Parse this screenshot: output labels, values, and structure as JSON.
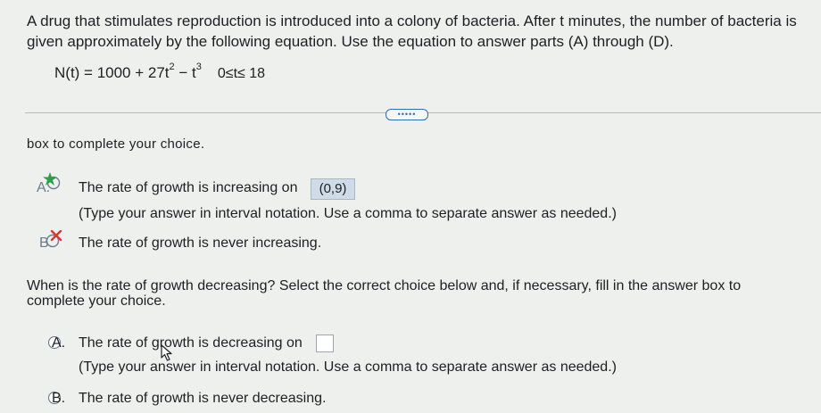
{
  "problem": {
    "line1": "A drug that stimulates reproduction is introduced into a colony of bacteria. After t minutes, the number of bacteria is",
    "line2": "given approximately by the following equation. Use the equation to answer parts (A) through (D).",
    "equation_lhs": "N(t) = 1000 + 27t",
    "exp1": "2",
    "equation_mid": " − t",
    "exp2": "3",
    "domain": "0≤t≤ 18"
  },
  "more_button": "•••••",
  "partial_instruction": "box to complete your choice.",
  "q1": {
    "optionA": {
      "letter": "A.",
      "text": "The rate of growth is increasing on",
      "answer": "(0,9)",
      "hint": "(Type your answer in interval notation. Use a comma to separate answer as needed.)"
    },
    "optionB": {
      "letter": "B.",
      "text": "The rate of growth is never increasing."
    }
  },
  "q2": {
    "prompt_line1": "When is the rate of growth decreasing? Select the correct choice below and, if necessary, fill in the answer box to",
    "prompt_line2": "complete your choice.",
    "optionA": {
      "letter": "A.",
      "text": "The rate of growth is decreasing on",
      "answer": "",
      "hint": "(Type your answer in interval notation. Use a comma to separate answer as needed.)"
    },
    "optionB": {
      "letter": "B.",
      "text": "The rate of growth is never decreasing."
    }
  },
  "colors": {
    "correct_star": "#2e9e4a",
    "incorrect_x": "#d43a2f",
    "answer_fill": "#cfdbe6",
    "link_blue": "#2f6fb4"
  },
  "icons": [
    "correct-star-icon",
    "incorrect-x-icon",
    "radio-button-icon",
    "mouse-cursor-icon"
  ]
}
